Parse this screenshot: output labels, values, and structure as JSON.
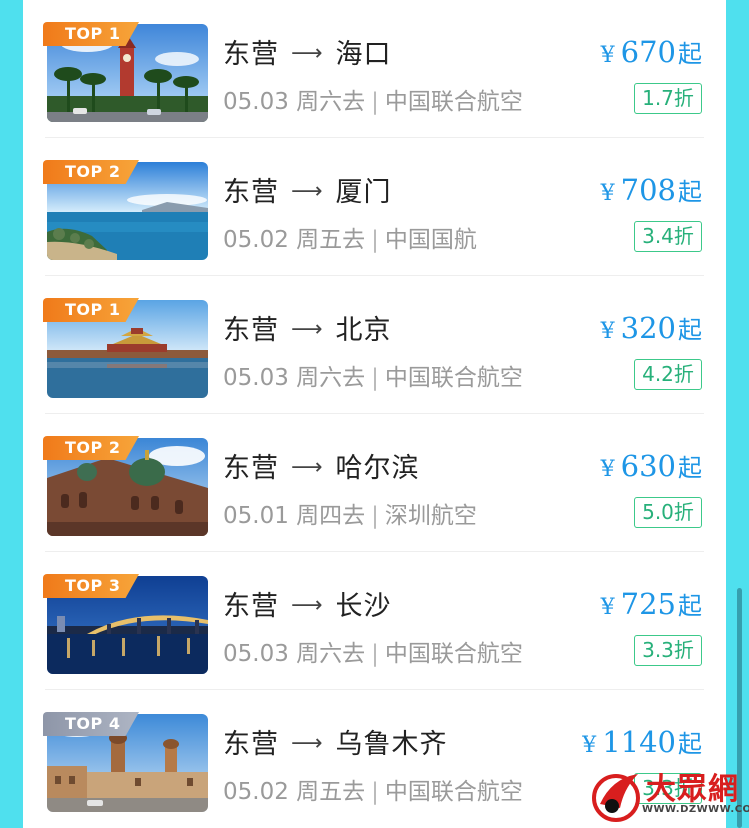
{
  "currency_symbol": "¥",
  "price_suffix": "起",
  "separator": "|",
  "flights": [
    {
      "badge": "TOP 1",
      "badge_color": "orange",
      "from": "东营",
      "to": "海口",
      "date": "05.03",
      "weekday": "周六去",
      "airline": "中国联合航空",
      "price": "670",
      "discount": "1.7折",
      "scene": "clock-tower-palms"
    },
    {
      "badge": "TOP 2",
      "badge_color": "orange",
      "from": "东营",
      "to": "厦门",
      "date": "05.02",
      "weekday": "周五去",
      "airline": "中国国航",
      "price": "708",
      "discount": "3.4折",
      "scene": "sea-coast"
    },
    {
      "badge": "TOP 1",
      "badge_color": "orange",
      "from": "东营",
      "to": "北京",
      "date": "05.03",
      "weekday": "周六去",
      "airline": "中国联合航空",
      "price": "320",
      "discount": "4.2折",
      "scene": "forbidden-city-moat"
    },
    {
      "badge": "TOP 2",
      "badge_color": "orange",
      "from": "东营",
      "to": "哈尔滨",
      "date": "05.01",
      "weekday": "周四去",
      "airline": "深圳航空",
      "price": "630",
      "discount": "5.0折",
      "scene": "st-sophia-cathedral"
    },
    {
      "badge": "TOP 3",
      "badge_color": "orange",
      "from": "东营",
      "to": "长沙",
      "date": "05.03",
      "weekday": "周六去",
      "airline": "中国联合航空",
      "price": "725",
      "discount": "3.3折",
      "scene": "night-bridge"
    },
    {
      "badge": "TOP 4",
      "badge_color": "gray",
      "from": "东营",
      "to": "乌鲁木齐",
      "date": "05.02",
      "weekday": "周五去",
      "airline": "中国联合航空",
      "price": "1140",
      "discount": "3.3折",
      "scene": "bazaar-towers"
    }
  ],
  "watermark": {
    "text": "大眾網",
    "url": "WWW.DZWWW.COM"
  },
  "colors": {
    "page_bg": "#4fe0ee",
    "price": "#1e96e6",
    "discount": "#27b07a",
    "badge_orange": "#f07a1a",
    "badge_gray": "#8e96a8"
  }
}
